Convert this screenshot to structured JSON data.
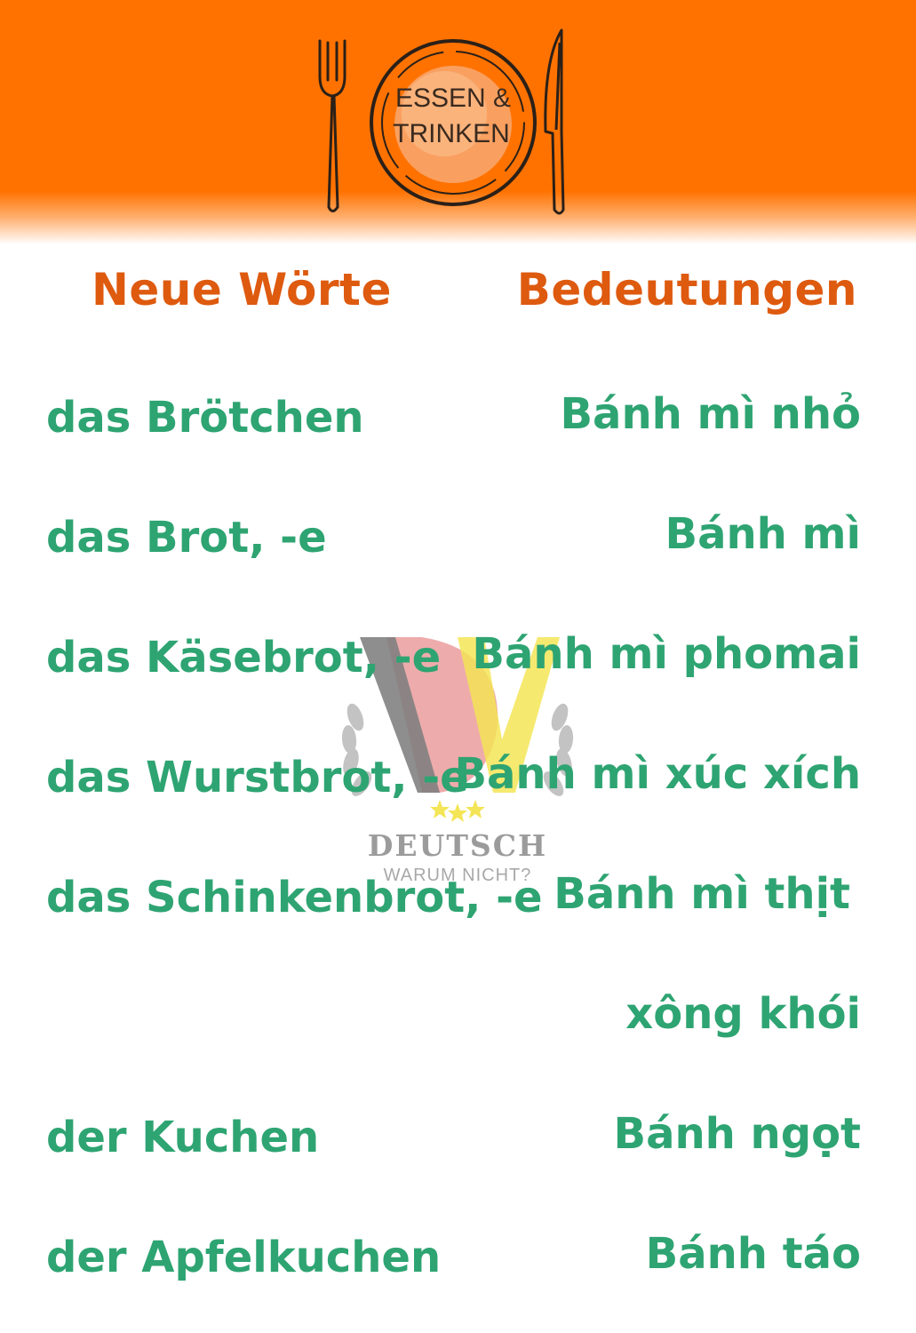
{
  "header": {
    "logo": {
      "line1": "ESSEN &",
      "line2": "TRINKEN",
      "icons": [
        "fork-icon",
        "plate-icon",
        "knife-icon"
      ]
    }
  },
  "columns": {
    "left_heading": "Neue Wörte",
    "right_heading": "Bedeutungen"
  },
  "vocabulary": [
    {
      "word": "das Brötchen",
      "meaning": "Bánh mì nhỏ"
    },
    {
      "word": "das Brot, -e",
      "meaning": "Bánh mì"
    },
    {
      "word": "das Käsebrot, -e",
      "meaning": "Bánh mì phomai"
    },
    {
      "word": "das Wurstbrot, -e",
      "meaning": "Bánh mì xúc xích"
    },
    {
      "word": "das Schinkenbrot, -e",
      "meaning": "Bánh mì thịt",
      "meaning_cont": "xông khói"
    },
    {
      "word": "der Kuchen",
      "meaning": "Bánh ngọt"
    },
    {
      "word": "der Apfelkuchen",
      "meaning": "Bánh táo"
    }
  ],
  "watermark": {
    "brand": "DEUTSCH",
    "tagline": "WARUM NICHT?",
    "icon": "dw-laurel-logo"
  },
  "colors": {
    "banner": "#ff7200",
    "heading": "#de5a0f",
    "word": "#2ea472"
  }
}
